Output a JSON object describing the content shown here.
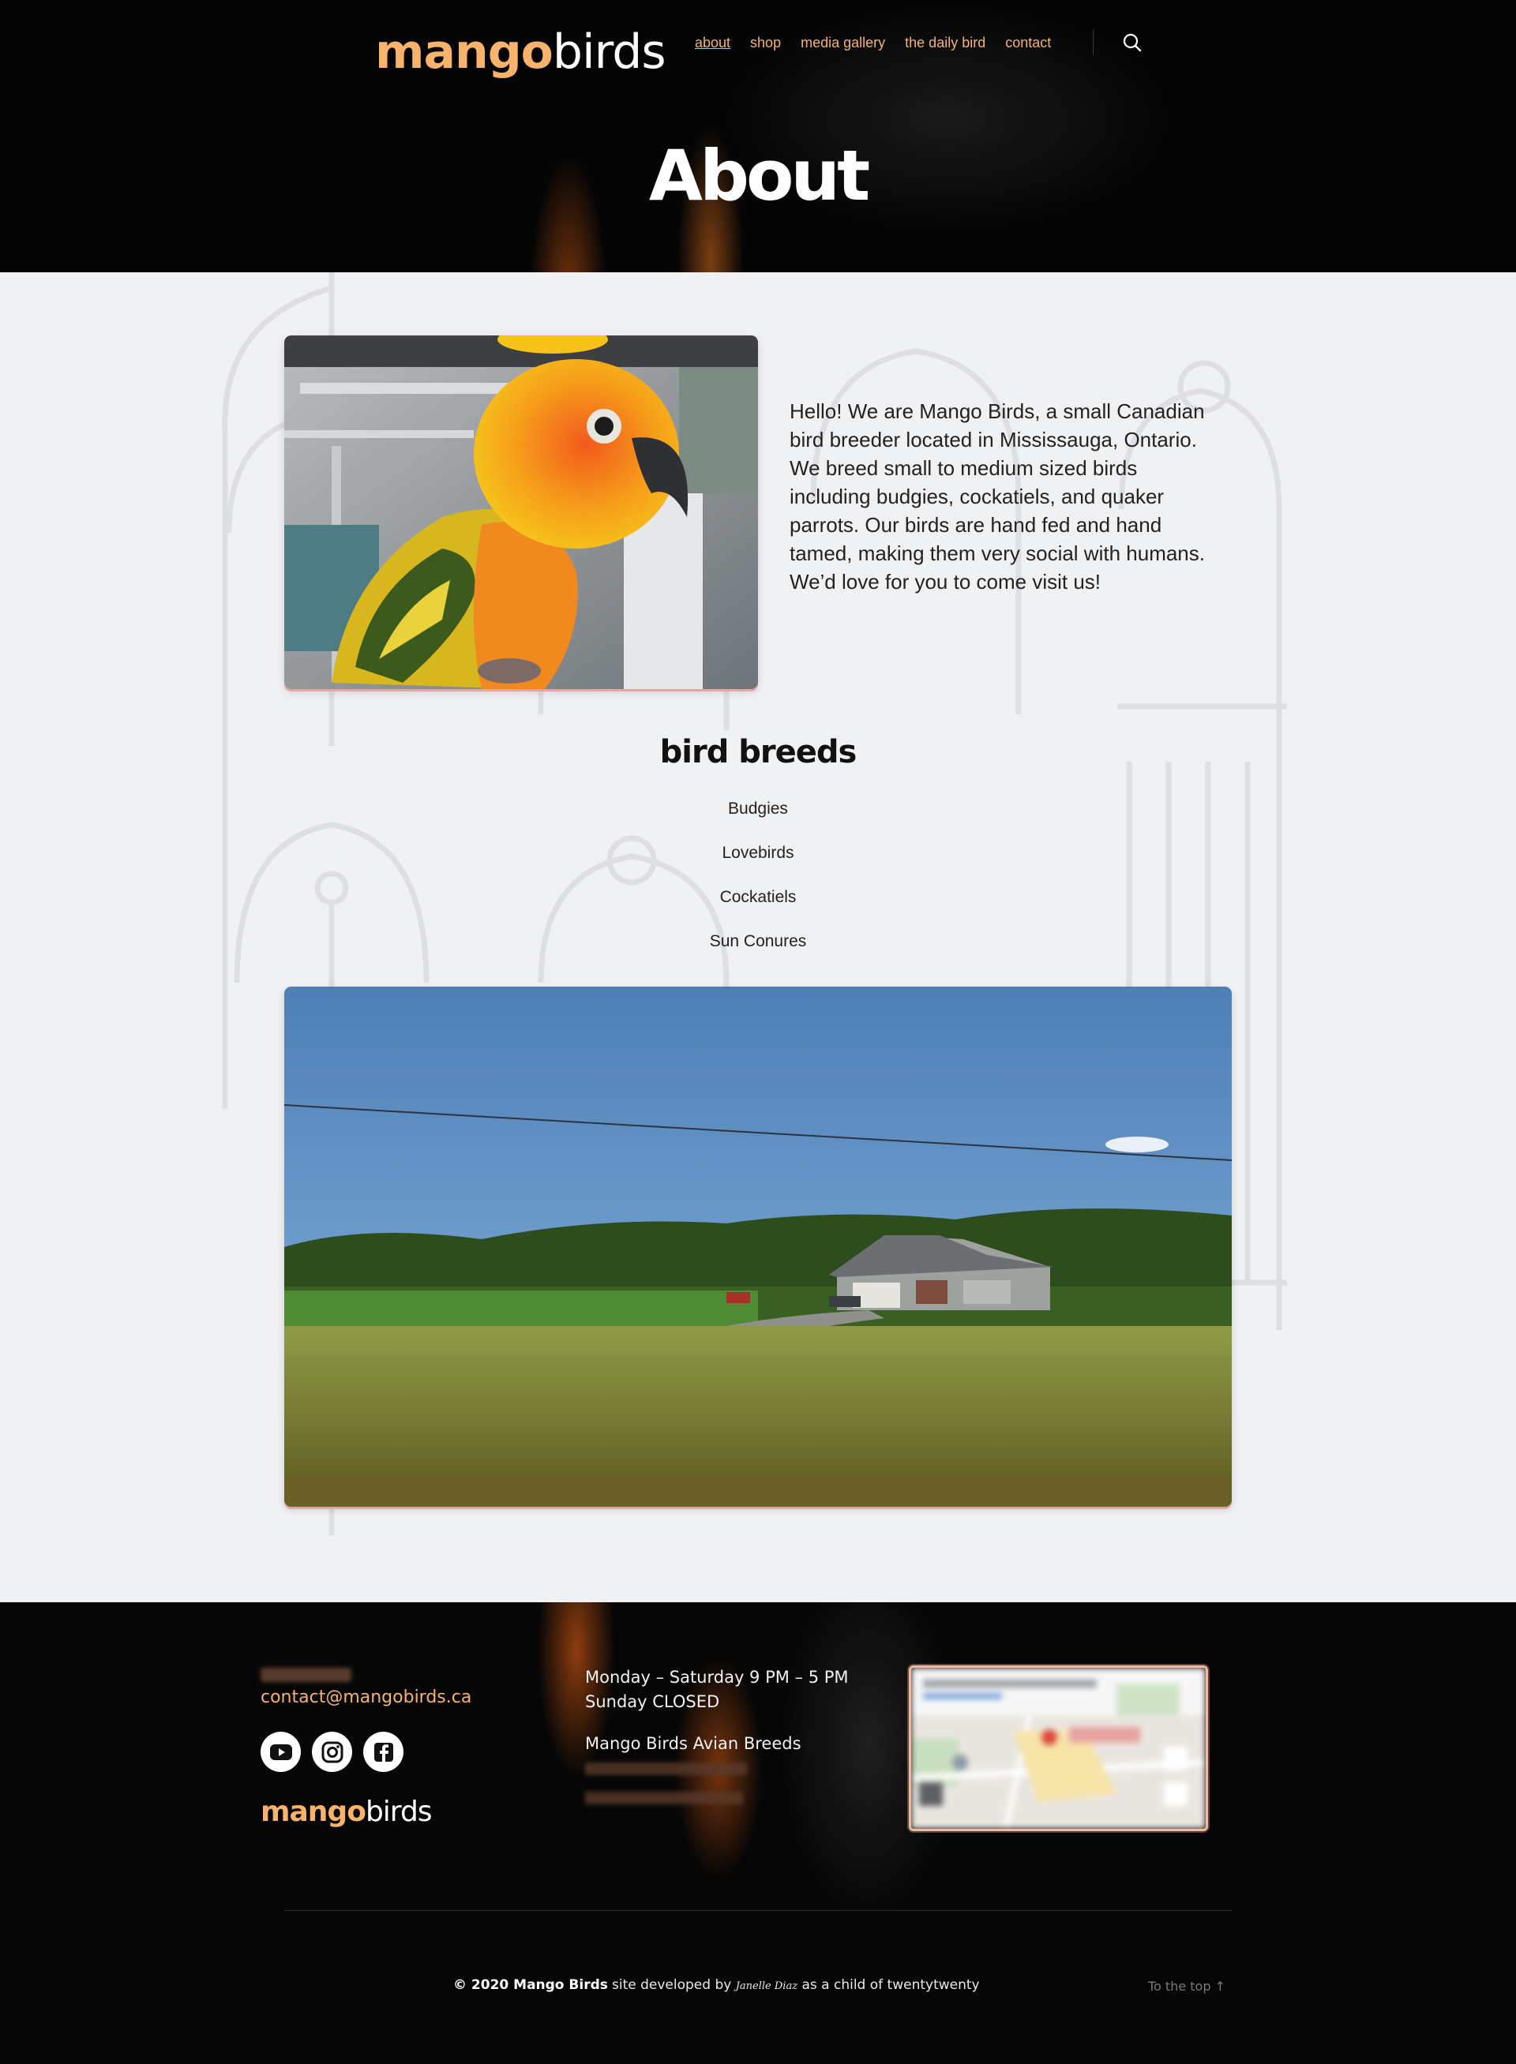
{
  "header": {
    "logo": {
      "part1": "mango",
      "part2": "birds"
    },
    "nav": [
      {
        "label": "about",
        "current": true
      },
      {
        "label": "shop"
      },
      {
        "label": "media gallery"
      },
      {
        "label": "the daily bird"
      },
      {
        "label": "contact"
      }
    ],
    "search_icon": "search-icon",
    "page_title": "About"
  },
  "main": {
    "intro": "Hello! We are Mango Birds, a small Canadian bird breeder located in Mississauga, Ontario. We breed small to medium sized birds including budgies, cockatiels, and quaker parrots. Our birds are hand fed and hand tamed, making them very social with humans. We’d love for you to come visit us!",
    "breeds_title": "bird breeds",
    "breeds": [
      "Budgies",
      "Lovebirds",
      "Cockatiels",
      "Sun Conures"
    ]
  },
  "footer": {
    "email": "contact@mangobirds.ca",
    "social": [
      {
        "name": "youtube-icon"
      },
      {
        "name": "instagram-icon"
      },
      {
        "name": "facebook-icon"
      }
    ],
    "logo": {
      "part1": "mango",
      "part2": "birds"
    },
    "hours": [
      "Monday – Saturday 9 PM – 5 PM",
      "Sunday CLOSED"
    ],
    "business_name": "Mango Birds Avian Breeds",
    "copyright": "© 2020 Mango Birds",
    "credit_prefix": "site developed by",
    "credit_signature": "Janelle Diaz",
    "credit_suffix": "as a child of twentytwenty",
    "to_top": "To the top ↑"
  },
  "colors": {
    "accent": "#f7b26b",
    "page_bg": "#f0f1f3",
    "header_bg": "#050505",
    "photo_shadow": "#e8a3a3"
  }
}
